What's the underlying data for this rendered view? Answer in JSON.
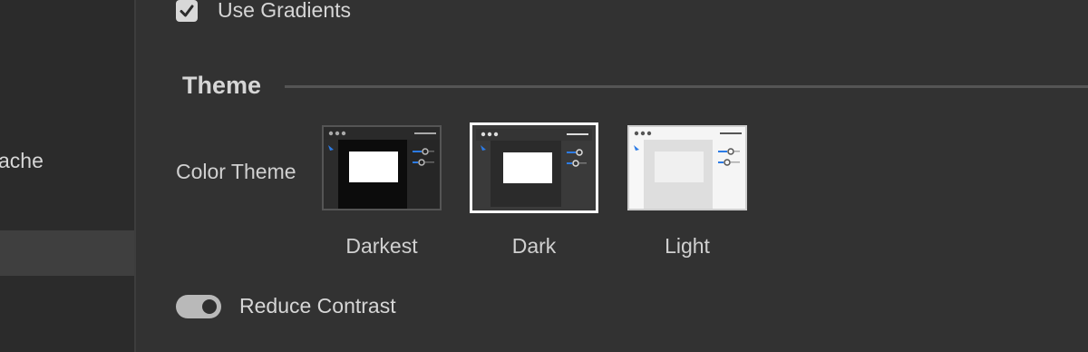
{
  "sidebar": {
    "items": [
      {
        "label": "ache"
      },
      {
        "label": ""
      }
    ]
  },
  "options": {
    "use_gradients": {
      "label": "Use Gradients",
      "checked": true
    }
  },
  "theme_section": {
    "title": "Theme",
    "color_theme_label": "Color Theme",
    "options": [
      {
        "label": "Darkest",
        "selected": false
      },
      {
        "label": "Dark",
        "selected": true
      },
      {
        "label": "Light",
        "selected": false
      }
    ]
  },
  "reduce_contrast": {
    "label": "Reduce Contrast",
    "on": true
  },
  "colors": {
    "panel": "#323232",
    "sidebar": "#2b2b2b",
    "accent_blue": "#2c7be5",
    "selection_border": "#ffffff"
  }
}
